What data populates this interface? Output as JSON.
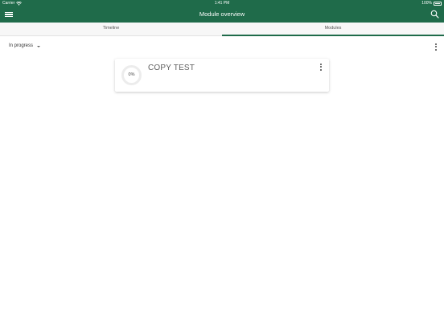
{
  "status_bar": {
    "carrier": "Carrier",
    "time": "1:41 PM",
    "battery": "100%"
  },
  "header": {
    "title": "Module overview",
    "background": "#1f6b4a"
  },
  "tabs": [
    {
      "label": "Timeline",
      "active": false
    },
    {
      "label": "Modules",
      "active": true
    }
  ],
  "filter": {
    "selected": "In progress"
  },
  "modules": [
    {
      "title": "COPY TEST",
      "progress_label": "0%",
      "progress": 0
    }
  ],
  "icons": {
    "menu": "hamburger-icon",
    "search": "search-icon",
    "more": "more-vertical-icon",
    "wifi": "wifi-icon",
    "battery": "battery-icon"
  }
}
